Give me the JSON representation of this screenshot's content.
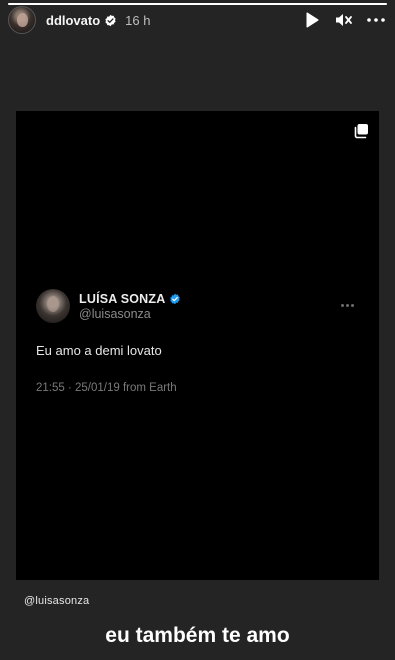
{
  "story": {
    "progress": 1.0,
    "user": {
      "username": "ddlovato",
      "time": "16 h"
    }
  },
  "tweet": {
    "name": "LUÍSA SONZA",
    "handle": "@luisasonza",
    "text": "Eu amo a demi lovato",
    "meta": "21:55 · 25/01/19 from Earth"
  },
  "mention": "@luisasonza",
  "caption": "eu também te amo",
  "caption2": "",
  "icons": {
    "play": "play-icon",
    "mute": "speaker-muted-icon",
    "more": "more-horizontal-icon",
    "copy": "copy-icon",
    "verified": "verified-badge-icon"
  },
  "colors": {
    "verified": "#1d9bf0",
    "background": "#242424",
    "post": "#000000"
  }
}
